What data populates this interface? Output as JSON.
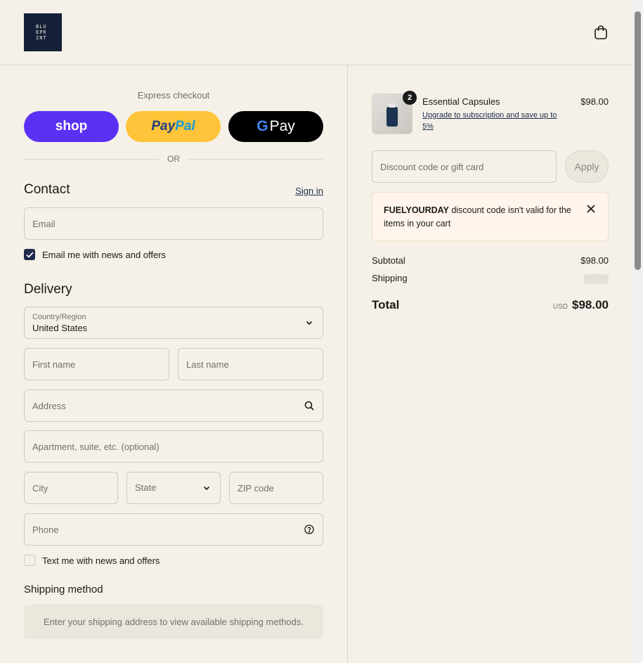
{
  "header": {
    "logo_lines": [
      "BLU",
      "EPR",
      "INT"
    ]
  },
  "express": {
    "title": "Express checkout",
    "shop_label": "shop",
    "paypal_label_a": "Pay",
    "paypal_label_b": "Pal",
    "gpay_g": "G",
    "gpay_label": "Pay",
    "or_text": "OR"
  },
  "contact": {
    "title": "Contact",
    "sign_in": "Sign in",
    "email_placeholder": "Email",
    "newsletter_label": "Email me with news and offers",
    "newsletter_checked": true
  },
  "delivery": {
    "title": "Delivery",
    "country_label": "Country/Region",
    "country_value": "United States",
    "first_name": "First name",
    "last_name": "Last name",
    "address": "Address",
    "apartment": "Apartment, suite, etc. (optional)",
    "city": "City",
    "state": "State",
    "zip": "ZIP code",
    "phone": "Phone",
    "sms_label": "Text me with news and offers",
    "sms_checked": false
  },
  "shipping_method": {
    "title": "Shipping method",
    "message": "Enter your shipping address to view available shipping methods."
  },
  "summary": {
    "product": {
      "name": "Essential Capsules",
      "quantity": "2",
      "upgrade_text": "Upgrade to subscription and save up to 5%",
      "price": "$98.00"
    },
    "discount_placeholder": "Discount code or gift card",
    "apply_label": "Apply",
    "alert_code": "FUELYOURDAY",
    "alert_text": " discount code isn't valid for the items in your cart",
    "subtotal_label": "Subtotal",
    "subtotal_value": "$98.00",
    "shipping_label": "Shipping",
    "total_label": "Total",
    "total_currency": "USD",
    "total_value": "$98.00"
  },
  "colors": {
    "background": "#f5f1e8",
    "shop_purple": "#5a31f4",
    "paypal_yellow": "#ffc439",
    "accent_navy": "#1f2a4a"
  }
}
